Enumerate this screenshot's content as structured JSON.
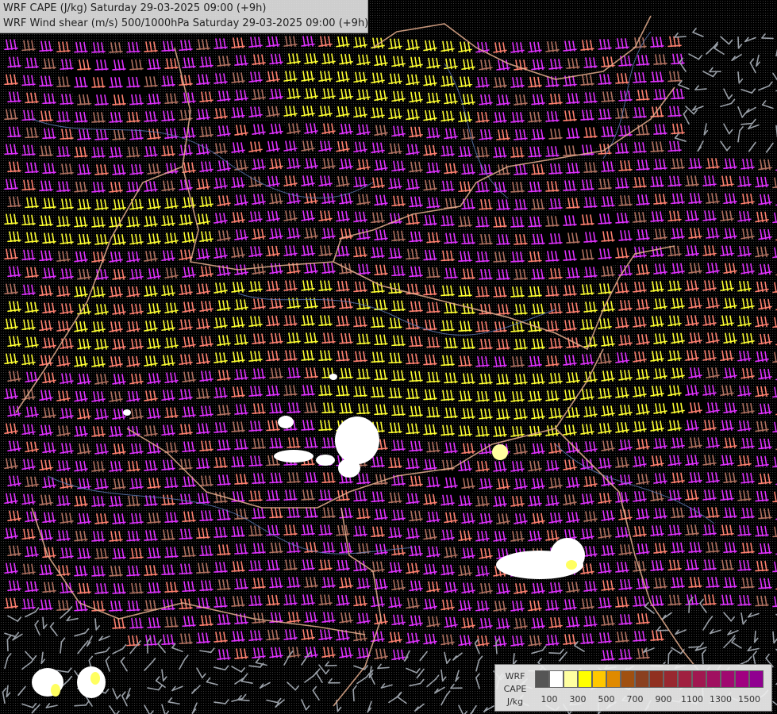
{
  "title": {
    "line1": "WRF CAPE (J/kg) Saturday 29-03-2025 09:00 (+9h)",
    "line2": "WRF Wind shear (m/s) 500/1000hPa Saturday 29-03-2025 09:00 (+9h)"
  },
  "legend": {
    "label_model": "WRF",
    "label_field": "CAPE",
    "label_unit": "J/kg",
    "colors": [
      "#555555",
      "#ffffff",
      "#ffffa0",
      "#ffff00",
      "#ffc800",
      "#e08a00",
      "#a05010",
      "#8a4020",
      "#903020",
      "#982830",
      "#a02040",
      "#a01850",
      "#a01060",
      "#a00870",
      "#a00080",
      "#900090"
    ],
    "ticks": [
      "100",
      "300",
      "500",
      "700",
      "900",
      "1100",
      "1300",
      "1500"
    ]
  },
  "barb_colors": {
    "yellow": "#ffff30",
    "magenta": "#e030ff",
    "salmon": "#ff8070",
    "brown": "#b07060",
    "grey": "#9aa0a8",
    "border": "#e8b090",
    "river": "#6080c0"
  }
}
